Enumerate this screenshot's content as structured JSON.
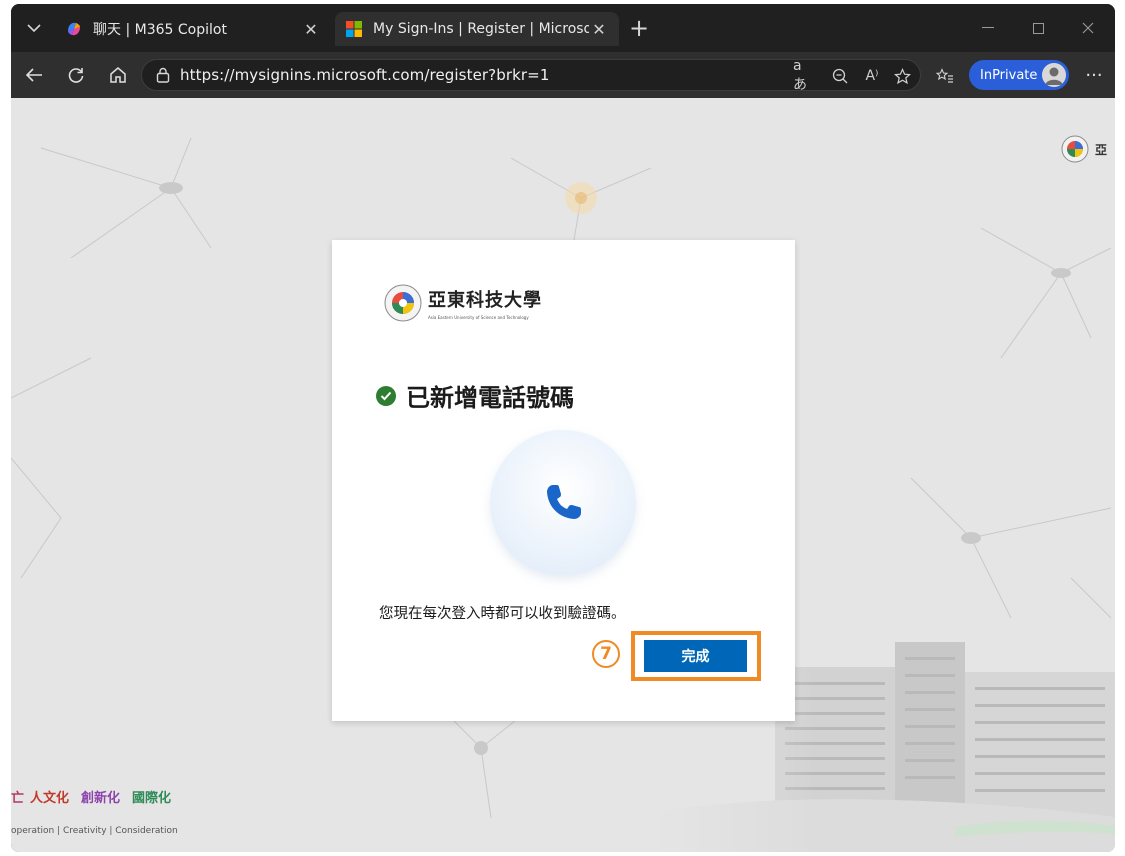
{
  "browser": {
    "tabs": [
      {
        "title": "聊天 | M365 Copilot",
        "active": false
      },
      {
        "title": "My Sign-Ins | Register | Microsoft.c",
        "active": true
      }
    ],
    "url": "https://mysignins.microsoft.com/register?brkr=1",
    "inprivate_label": "InPrivate",
    "colors": {
      "frame": "#202020",
      "toolbar": "#2f2f2f",
      "inprivate": "#2b5fd9"
    }
  },
  "page": {
    "corner_logo_glyph": "亞",
    "slogan": {
      "part1": "亡",
      "part2": "人文化",
      "part3": "創新化",
      "part4": "國際化"
    },
    "motto": "operation | Creativity | Consideration"
  },
  "dialog": {
    "org_name": "亞東科技大學",
    "org_subtitle": "Asia Eastern University of Science and Technology",
    "title": "已新增電話號碼",
    "message": "您現在每次登入時都可以收到驗證碼。",
    "done_label": "完成",
    "step_number": "7",
    "colors": {
      "primary": "#0067b8",
      "highlight": "#f08a24",
      "success": "#2e7d32"
    }
  }
}
